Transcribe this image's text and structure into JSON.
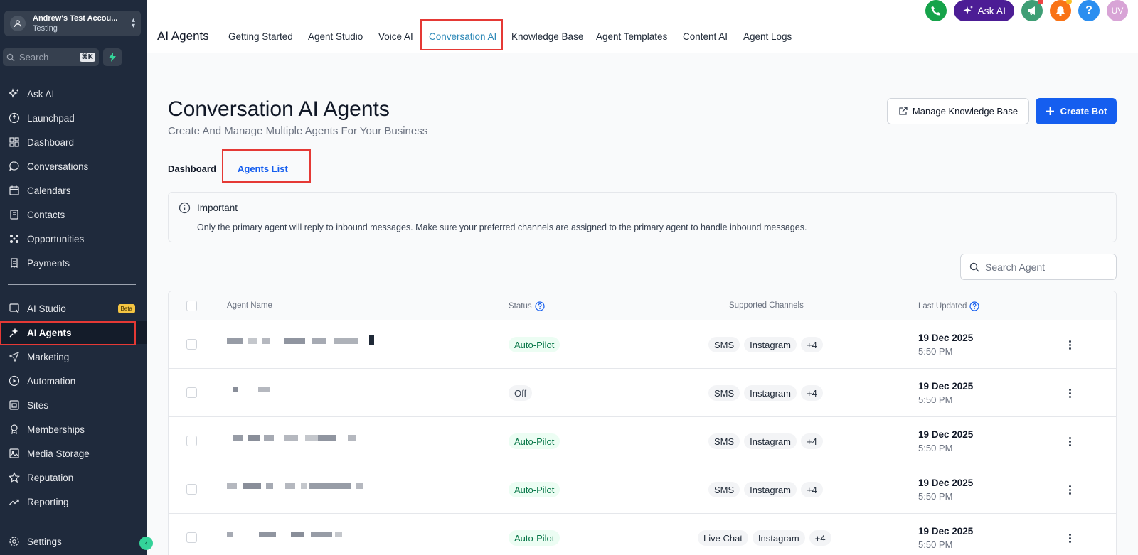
{
  "account": {
    "name": "Andrew's Test Accou...",
    "subtitle": "Testing"
  },
  "sidebar": {
    "search_placeholder": "Search",
    "search_shortcut": "⌘K",
    "items": [
      {
        "label": "Ask AI",
        "icon": "sparkle-icon"
      },
      {
        "label": "Launchpad",
        "icon": "rocket-icon"
      },
      {
        "label": "Dashboard",
        "icon": "grid-icon"
      },
      {
        "label": "Conversations",
        "icon": "chat-bubble-icon"
      },
      {
        "label": "Calendars",
        "icon": "calendar-icon"
      },
      {
        "label": "Contacts",
        "icon": "contacts-book-icon"
      },
      {
        "label": "Opportunities",
        "icon": "opportunities-icon"
      },
      {
        "label": "Payments",
        "icon": "receipt-icon"
      }
    ],
    "items2": [
      {
        "label": "AI Studio",
        "icon": "ai-studio-icon",
        "badge": "Beta"
      },
      {
        "label": "AI Agents",
        "icon": "ai-agents-icon"
      },
      {
        "label": "Marketing",
        "icon": "paper-plane-icon"
      },
      {
        "label": "Automation",
        "icon": "automation-icon"
      },
      {
        "label": "Sites",
        "icon": "sites-icon"
      },
      {
        "label": "Memberships",
        "icon": "membership-icon"
      },
      {
        "label": "Media Storage",
        "icon": "image-icon"
      },
      {
        "label": "Reputation",
        "icon": "star-icon"
      },
      {
        "label": "Reporting",
        "icon": "trend-up-icon"
      }
    ],
    "settings_label": "Settings"
  },
  "topbar": {
    "title": "AI Agents",
    "tabs": [
      "Getting Started",
      "Agent Studio",
      "Voice AI",
      "Conversation AI",
      "Knowledge Base",
      "Agent Templates",
      "Content AI",
      "Agent Logs"
    ],
    "active_tab": "Conversation AI",
    "ask_ai_label": "Ask AI",
    "avatar_initials": "UV",
    "help_label": "?"
  },
  "main": {
    "title": "Conversation AI Agents",
    "subtitle": "Create And Manage Multiple Agents For Your Business",
    "manage_kb_label": "Manage Knowledge Base",
    "create_bot_label": "Create Bot",
    "tabs": [
      "Dashboard",
      "Agents List"
    ],
    "active_tab": "Agents List",
    "notice": {
      "title": "Important",
      "text": "Only the primary agent will reply to inbound messages. Make sure your preferred channels are assigned to the primary agent to handle inbound messages."
    },
    "search_placeholder": "Search Agent"
  },
  "table": {
    "columns": [
      "Agent Name",
      "Status",
      "Supported Channels",
      "Last Updated"
    ],
    "rows": [
      {
        "status": "Auto-Pilot",
        "channels": [
          "SMS",
          "Instagram",
          "+4"
        ],
        "date": "19 Dec 2025",
        "time": "5:50 PM"
      },
      {
        "status": "Off",
        "channels": [
          "SMS",
          "Instagram",
          "+4"
        ],
        "date": "19 Dec 2025",
        "time": "5:50 PM"
      },
      {
        "status": "Auto-Pilot",
        "channels": [
          "SMS",
          "Instagram",
          "+4"
        ],
        "date": "19 Dec 2025",
        "time": "5:50 PM"
      },
      {
        "status": "Auto-Pilot",
        "channels": [
          "SMS",
          "Instagram",
          "+4"
        ],
        "date": "19 Dec 2025",
        "time": "5:50 PM"
      },
      {
        "status": "Auto-Pilot",
        "channels": [
          "Live Chat",
          "Instagram",
          "+4"
        ],
        "date": "19 Dec 2025",
        "time": "5:50 PM"
      }
    ]
  },
  "colors": {
    "sidebar_bg": "#1f2a3c",
    "primary": "#155eef",
    "highlight": "#e53935",
    "active_tab": "#2f8ab8"
  }
}
